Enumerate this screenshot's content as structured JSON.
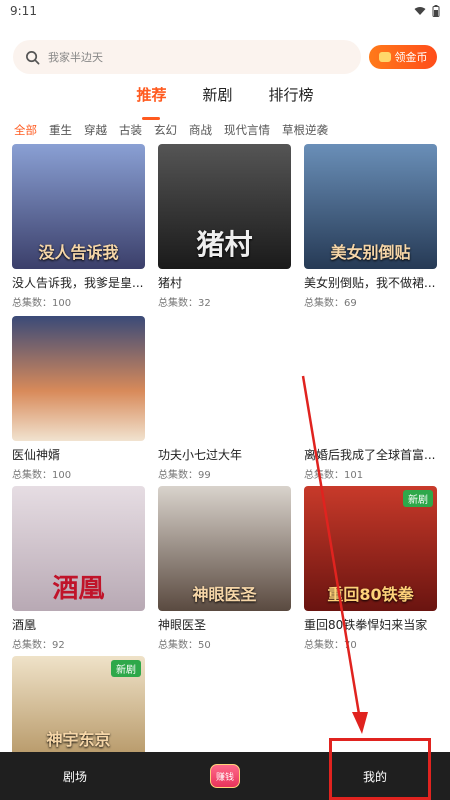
{
  "status_bar": {
    "time": "9:11"
  },
  "search": {
    "placeholder": "我家半边天",
    "coins_label": "领金币"
  },
  "main_tabs": [
    {
      "label": "推荐",
      "active": true
    },
    {
      "label": "新剧",
      "active": false
    },
    {
      "label": "排行榜",
      "active": false
    }
  ],
  "categories": [
    {
      "label": "全部",
      "active": true
    },
    {
      "label": "重生"
    },
    {
      "label": "穿越"
    },
    {
      "label": "古装"
    },
    {
      "label": "玄幻"
    },
    {
      "label": "商战"
    },
    {
      "label": "现代言情"
    },
    {
      "label": "草根逆袭"
    }
  ],
  "dramas": [
    {
      "title": "没人告诉我，我爹是皇...",
      "count": "总集数：100",
      "color": "#6b7fb8",
      "poster_text": "没人告诉我"
    },
    {
      "title": "猪村",
      "count": "总集数：32",
      "color": "#3a3a3a",
      "poster_text": "猪村"
    },
    {
      "title": "美女别倒贴，我不做裙...",
      "count": "总集数：69",
      "color": "#3d5f8a",
      "poster_text": "美女别倒贴"
    },
    {
      "title": "医仙神婿",
      "count": "总集数：100",
      "color": "#b86a4a",
      "poster_text": ""
    },
    {
      "title": "功夫小七过大年",
      "count": "总集数：99",
      "color": "",
      "poster_text": ""
    },
    {
      "title": "离婚后我成了全球首富...",
      "count": "总集数：101",
      "color": "",
      "poster_text": ""
    },
    {
      "title": "酒凰",
      "count": "总集数：92",
      "color": "#d9cfd6",
      "poster_text": "酒凰"
    },
    {
      "title": "神眼医圣",
      "count": "总集数：50",
      "color": "#c9c2ba",
      "poster_text": "神眼医圣"
    },
    {
      "title": "重回80铁拳悍妇来当家",
      "count": "总集数：70",
      "color": "#b52a22",
      "poster_text": "重回80铁拳",
      "badge": "新剧"
    },
    {
      "title": "",
      "count": "",
      "color": "#e9d7b8",
      "poster_text": "神宇东京",
      "badge": "新剧"
    }
  ],
  "bottom_nav": {
    "theater": "剧场",
    "earn": "赚钱",
    "mine": "我的"
  }
}
